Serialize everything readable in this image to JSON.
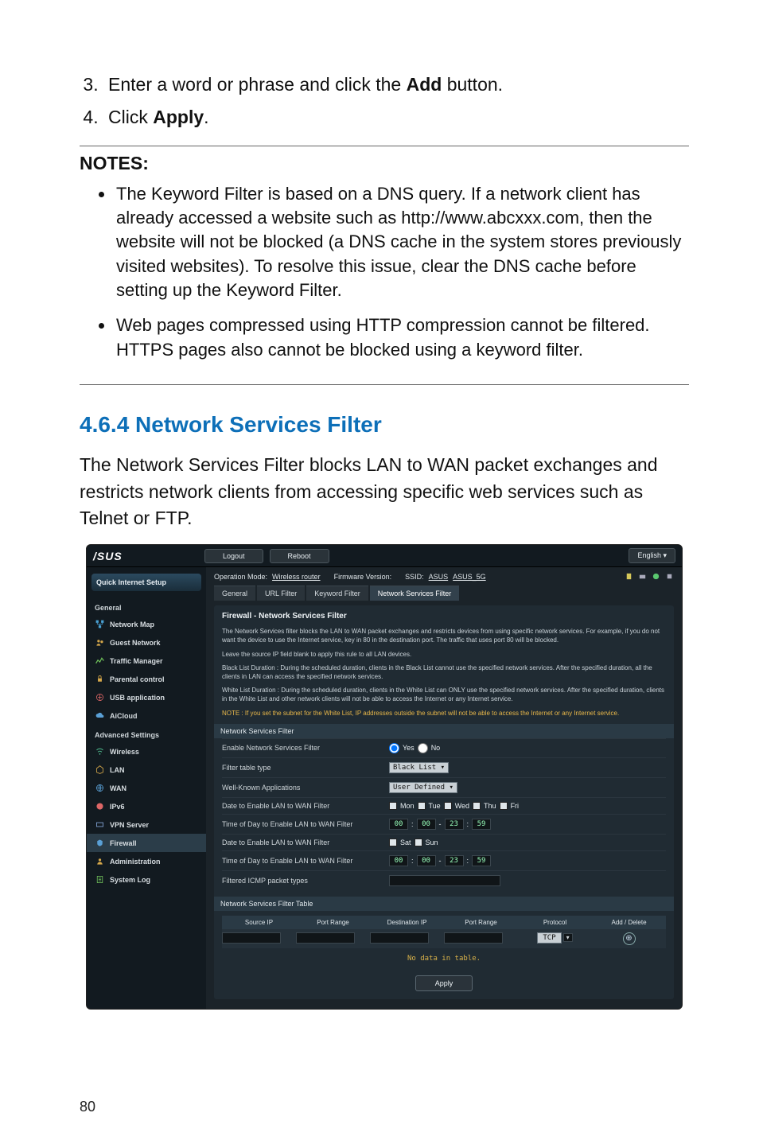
{
  "instructions": {
    "step3": "Enter a word or phrase and click the ",
    "step3_bold": "Add",
    "step3_after": " button.",
    "step4": "Click ",
    "step4_bold": "Apply",
    "step4_after": "."
  },
  "notes": {
    "title": "NOTES:",
    "items": [
      "The Keyword Filter is based on a DNS query. If a network client has already accessed a website such as http://www.abcxxx.com, then the website will not be blocked (a DNS cache in the system stores previously visited websites). To resolve this issue, clear the DNS cache before setting up the Keyword Filter.",
      "Web pages compressed using HTTP compression cannot be filtered. HTTPS pages also cannot be blocked using a keyword filter."
    ]
  },
  "section": {
    "heading": "4.6.4 Network Services Filter",
    "body": "The Network Services Filter blocks LAN to WAN packet exchanges and restricts network clients from accessing specific web services such as Telnet or FTP."
  },
  "page_number": "80",
  "router": {
    "logo": "/SUS",
    "logout": "Logout",
    "reboot": "Reboot",
    "language": "English",
    "op_mode_label": "Operation Mode:",
    "op_mode_value": "Wireless router",
    "fw_label": "Firmware Version:",
    "ssid_label": "SSID:",
    "ssid1": "ASUS",
    "ssid2": "ASUS_5G",
    "tabs": [
      "General",
      "URL Filter",
      "Keyword Filter",
      "Network Services Filter"
    ],
    "sidebar": {
      "quick": "Quick Internet Setup",
      "general_head": "General",
      "general_items": [
        "Network Map",
        "Guest Network",
        "Traffic Manager",
        "Parental control",
        "USB application",
        "AiCloud"
      ],
      "advanced_head": "Advanced Settings",
      "advanced_items": [
        "Wireless",
        "LAN",
        "WAN",
        "IPv6",
        "VPN Server",
        "Firewall",
        "Administration",
        "System Log"
      ]
    },
    "panel": {
      "title": "Firewall - Network Services Filter",
      "desc1": "The Network Services filter blocks the LAN to WAN packet exchanges and restricts devices from using specific network services. For example, if you do not want the device to use the Internet service, key in 80 in the destination port. The traffic that uses port 80 will be blocked.",
      "desc2": "Leave the source IP field blank to apply this rule to all LAN devices.",
      "desc3": "Black List Duration : During the scheduled duration, clients in the Black List cannot use the specified network services. After the specified duration, all the clients in LAN can access the specified network services.",
      "desc4": "White List Duration : During the scheduled duration, clients in the White List can ONLY use the specified network services. After the specified duration, clients in the White List and other network clients will not be able to access the Internet or any Internet service.",
      "note": "NOTE : If you set the subnet for the White List, IP addresses outside the subnet will not be able to access the Internet or any Internet service.",
      "subhead1": "Network Services Filter",
      "rows": {
        "enable_label": "Enable Network Services Filter",
        "enable_yes": "Yes",
        "enable_no": "No",
        "filter_type_label": "Filter table type",
        "filter_type_value": "Black List",
        "wellknown_label": "Well-Known Applications",
        "wellknown_value": "User Defined",
        "date1_label": "Date to Enable LAN to WAN Filter",
        "days1": [
          "Mon",
          "Tue",
          "Wed",
          "Thu",
          "Fri"
        ],
        "time1_label": "Time of Day to Enable LAN to WAN Filter",
        "t1": [
          "00",
          "00",
          "23",
          "59"
        ],
        "date2_label": "Date to Enable LAN to WAN Filter",
        "days2": [
          "Sat",
          "Sun"
        ],
        "time2_label": "Time of Day to Enable LAN to WAN Filter",
        "t2": [
          "00",
          "00",
          "23",
          "59"
        ],
        "icmp_label": "Filtered ICMP packet types"
      },
      "subhead2": "Network Services Filter Table",
      "table_headers": [
        "Source IP",
        "Port Range",
        "Destination IP",
        "Port Range",
        "Protocol",
        "Add / Delete"
      ],
      "protocol_value": "TCP",
      "no_data": "No data in table.",
      "apply": "Apply"
    }
  }
}
